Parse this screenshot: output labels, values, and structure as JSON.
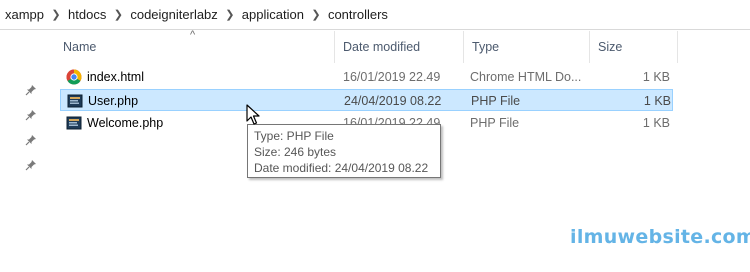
{
  "breadcrumb": [
    "xampp",
    "htdocs",
    "codeigniterlabz",
    "application",
    "controllers"
  ],
  "breadcrumb_separator": ">",
  "columns": {
    "name": "Name",
    "date": "Date modified",
    "type": "Type",
    "size": "Size"
  },
  "sort_indicator": "^",
  "pin_icon": "pin-icon",
  "files": [
    {
      "name": "index.html",
      "date": "16/01/2019 22.49",
      "type": "Chrome HTML Do...",
      "size": "1 KB",
      "icon": "chrome-icon"
    },
    {
      "name": "User.php",
      "date": "24/04/2019 08.22",
      "type": "PHP File",
      "size": "1 KB",
      "icon": "php-file-icon",
      "selected": true
    },
    {
      "name": "Welcome.php",
      "date": "16/01/2019 22.49",
      "type": "PHP File",
      "size": "1 KB",
      "icon": "php-file-icon"
    }
  ],
  "tooltip": {
    "type_line": "Type: PHP File",
    "size_line": "Size: 246 bytes",
    "date_line": "Date modified: 24/04/2019 08.22"
  },
  "watermark": "ilmuwebsite.com",
  "colors": {
    "selection_bg": "#cce8ff",
    "selection_border": "#99d1ff",
    "watermark": "#64b4e6"
  }
}
